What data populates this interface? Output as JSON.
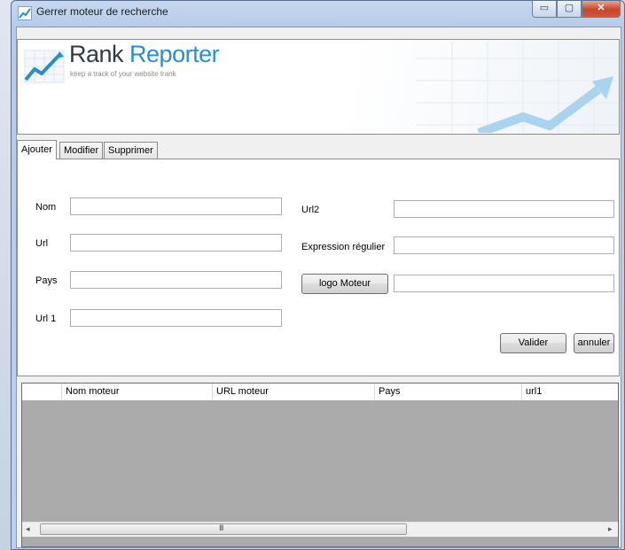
{
  "window": {
    "title": "Gerrer moteur de recherche",
    "controls": {
      "minimize": "▭",
      "maximize": "▢",
      "close": "✕"
    }
  },
  "banner": {
    "brand_first": "Rank",
    "brand_second": "Reporter",
    "tagline": "keep a track of your website trank",
    "colors": {
      "brand_dark": "#2e3b45",
      "brand_blue": "#2a8cd2"
    }
  },
  "tabs": [
    {
      "label": "Ajouter",
      "selected": true
    },
    {
      "label": "Modifier",
      "selected": false
    },
    {
      "label": "Supprimer",
      "selected": false
    }
  ],
  "form": {
    "nom_label": "Nom",
    "url_label": "Url",
    "pays_label": "Pays",
    "url1_label": "Url 1",
    "url2_label": "Url2",
    "expr_label": "Expression régulier",
    "logo_button": "logo Moteur",
    "values": {
      "nom": "",
      "url": "",
      "pays": "",
      "url1": "",
      "url2": "",
      "expr": "",
      "logo": ""
    },
    "valider_button": "Valider",
    "annuler_button": "annuler"
  },
  "grid": {
    "columns": [
      "Nom moteur",
      "URL moteur",
      "Pays",
      "url1"
    ],
    "rows": [],
    "scroll": {
      "left": "◂",
      "right": "▸",
      "grip": "III"
    }
  }
}
